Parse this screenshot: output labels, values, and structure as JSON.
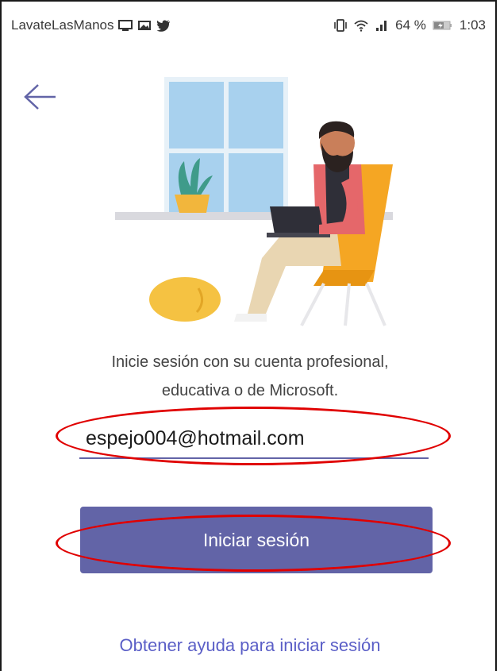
{
  "status_bar": {
    "app_name": "LavateLasManos",
    "battery_percent": "64 %",
    "time": "1:03",
    "icons": [
      "monitor-icon",
      "image-icon",
      "twitter-icon",
      "vibrate-icon",
      "wifi-icon",
      "signal-icon",
      "battery-icon"
    ]
  },
  "navigation": {
    "back_icon": "arrow-left-icon"
  },
  "login": {
    "intro_line1": "Inicie sesión con su cuenta profesional,",
    "intro_line2": "educativa o de Microsoft.",
    "email_value": "espejo004@hotmail.com",
    "sign_in_label": "Iniciar sesión",
    "help_label": "Obtener ayuda para iniciar sesión"
  },
  "colors": {
    "accent": "#6264a7",
    "link": "#5b5fc7",
    "annotation": "#e00000"
  }
}
